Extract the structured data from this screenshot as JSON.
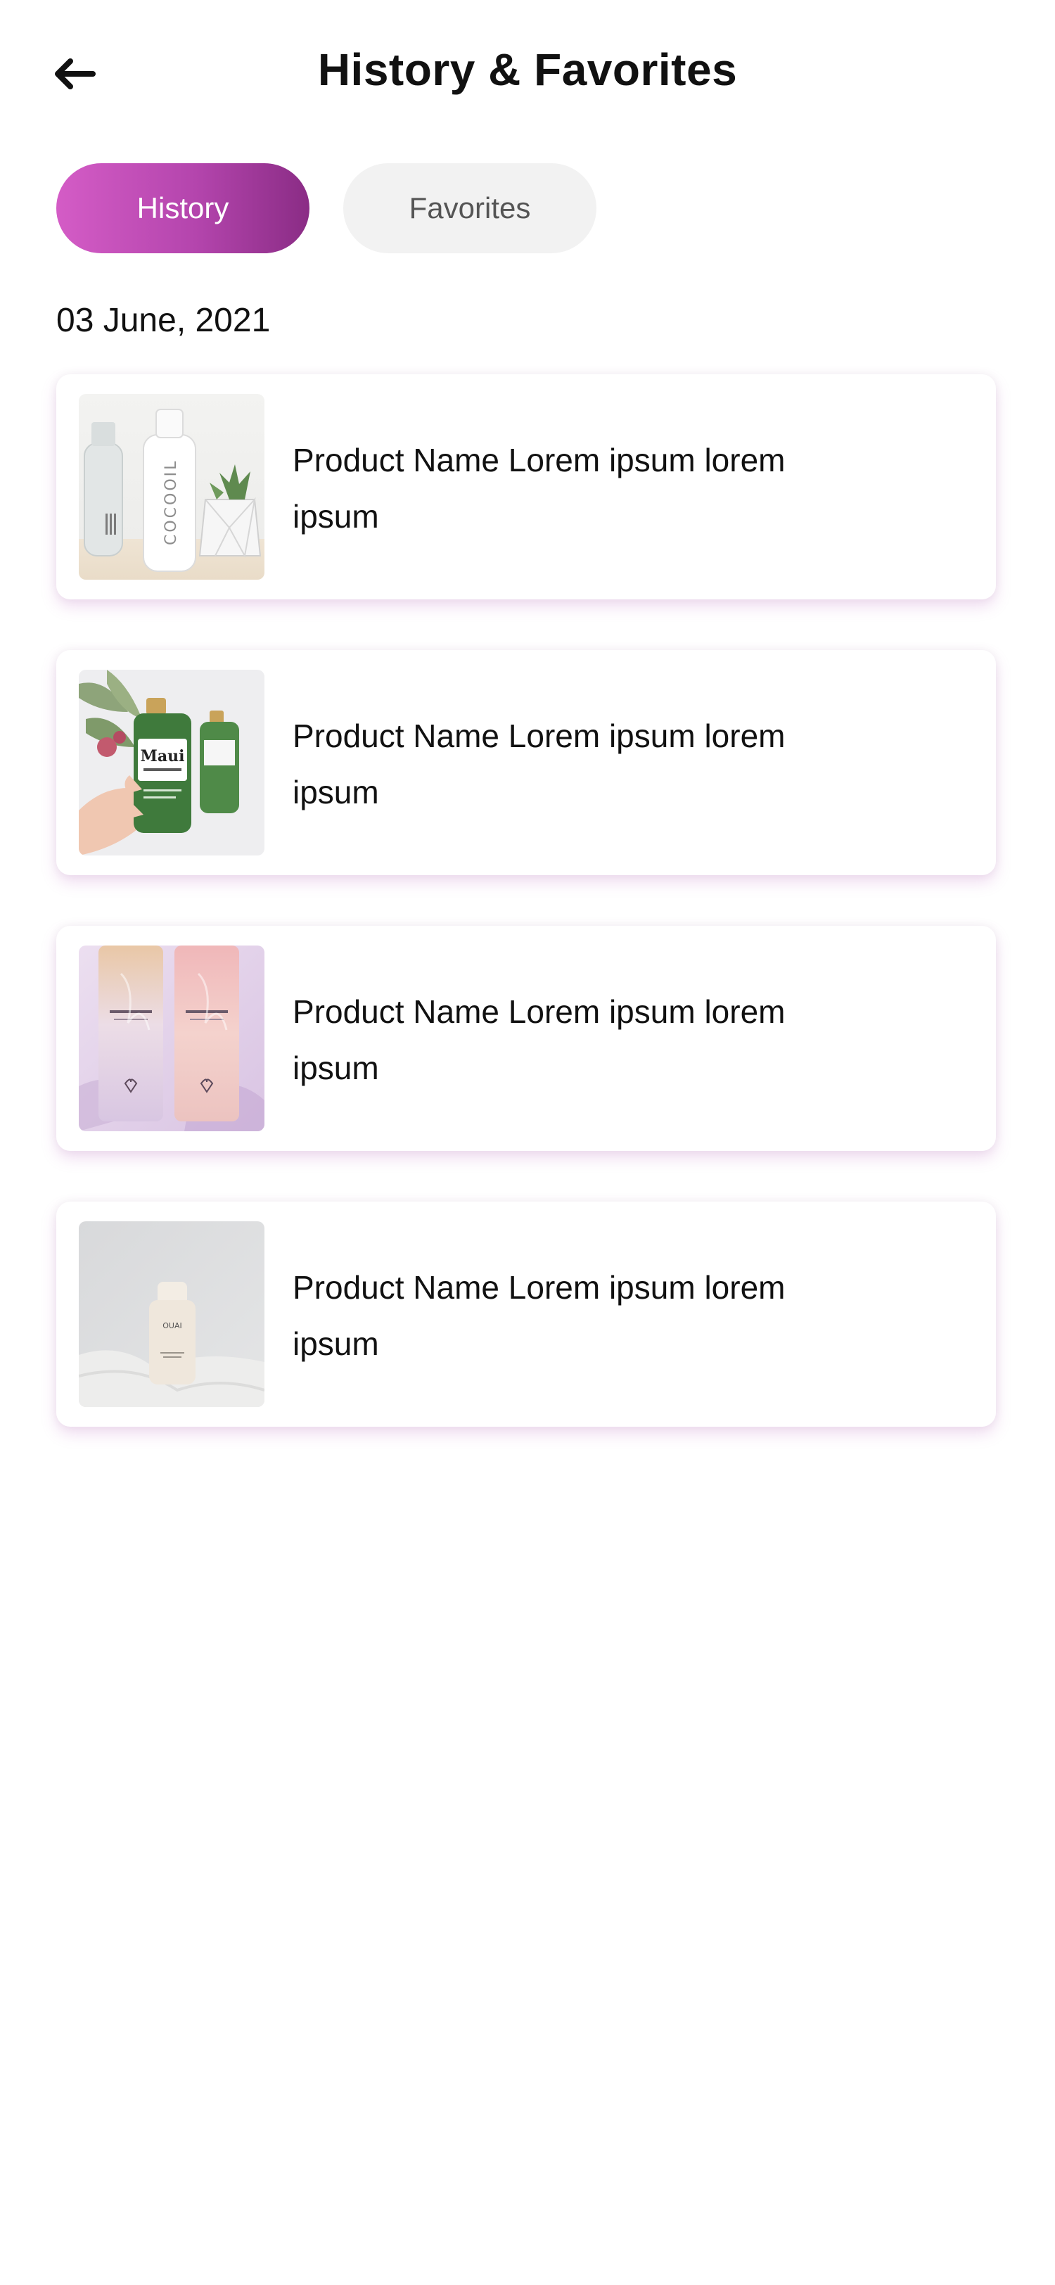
{
  "header": {
    "title": "History & Favorites",
    "back_icon": "arrow-left-icon"
  },
  "tabs": [
    {
      "label": "History",
      "active": true
    },
    {
      "label": "Favorites",
      "active": false
    }
  ],
  "date": "03 June, 2021",
  "products": [
    {
      "name": "Product Name Lorem ipsum lorem ipsum",
      "image_label": "COCOOIL"
    },
    {
      "name": "Product Name Lorem ipsum lorem ipsum",
      "image_label": "Maui"
    },
    {
      "name": "Product Name Lorem ipsum lorem ipsum"
    },
    {
      "name": "Product Name Lorem ipsum lorem ipsum",
      "image_label": "OUAI"
    }
  ],
  "colors": {
    "accent_start": "#d45cc6",
    "accent_end": "#8a2c85",
    "inactive_tab_bg": "#f2f2f2",
    "card_shadow": "#bc60be"
  }
}
